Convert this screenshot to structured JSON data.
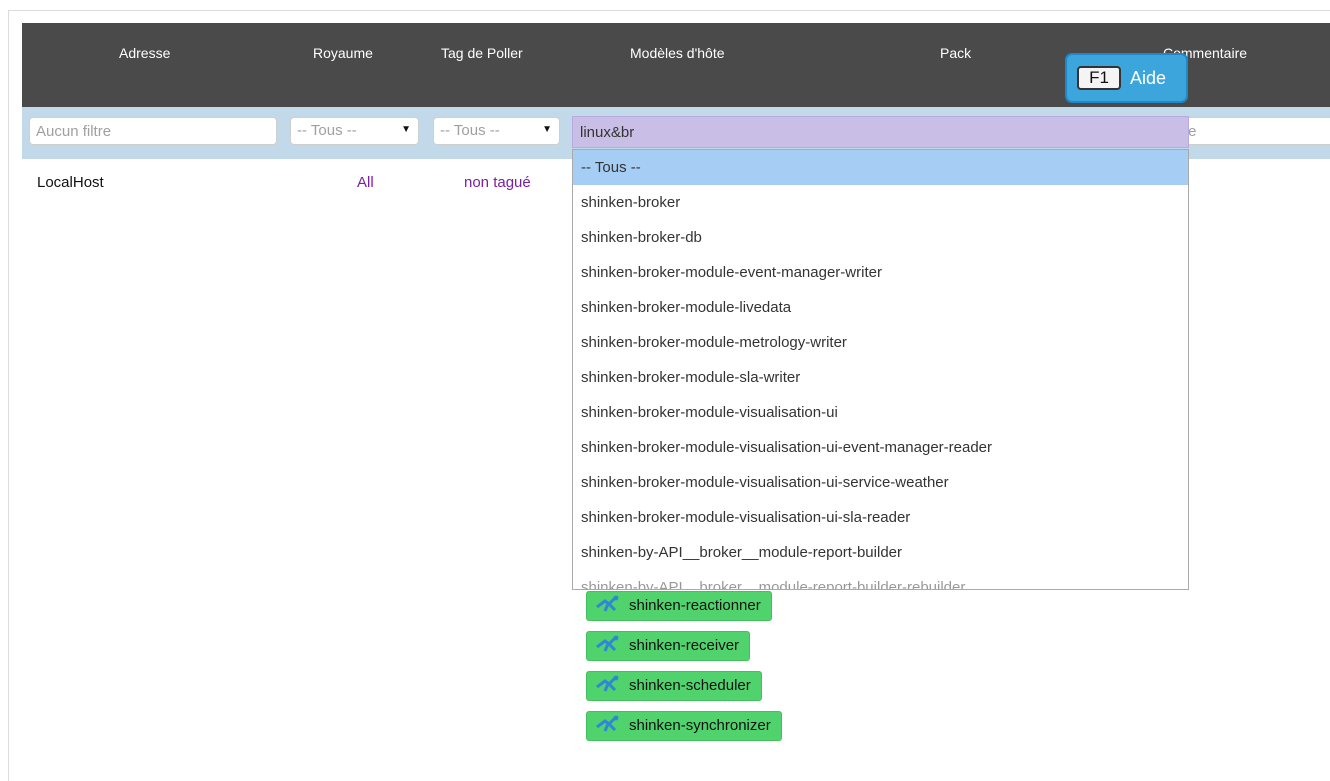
{
  "columns": {
    "address": "Adresse",
    "realm": "Royaume",
    "poller_tag": "Tag de Poller",
    "host_templates": "Modèles d'hôte",
    "pack": "Pack",
    "comment": "Commentaire"
  },
  "filters": {
    "address_placeholder": "Aucun filtre",
    "realm_value": "-- Tous --",
    "poller_tag_value": "-- Tous --",
    "host_template_value": "linux&br",
    "comment_placeholder_visible": "tre"
  },
  "dropdown": {
    "options": [
      "-- Tous --",
      "shinken-broker",
      "shinken-broker-db",
      "shinken-broker-module-event-manager-writer",
      "shinken-broker-module-livedata",
      "shinken-broker-module-metrology-writer",
      "shinken-broker-module-sla-writer",
      "shinken-broker-module-visualisation-ui",
      "shinken-broker-module-visualisation-ui-event-manager-reader",
      "shinken-broker-module-visualisation-ui-service-weather",
      "shinken-broker-module-visualisation-ui-sla-reader",
      "shinken-by-API__broker__module-report-builder",
      "shinken-by-API__broker__module-report-builder-rebuilder"
    ]
  },
  "row": {
    "host": "LocalHost",
    "realm": "All",
    "poller_tag": "non tagué",
    "templates": [
      "shinken-reactionner",
      "shinken-receiver",
      "shinken-scheduler",
      "shinken-synchronizer"
    ]
  },
  "help": {
    "key": "F1",
    "label": "Aide"
  },
  "colors": {
    "header_bg": "#4a4a4a",
    "filter_bar_bg": "#c2d9ea",
    "combo_bg": "#c9bfe6",
    "selected_option_bg": "#a6cdf3",
    "template_tag_bg": "#50d26d",
    "link_purple": "#7b1fa2",
    "help_bg": "#3ba5dc"
  },
  "icons": {
    "template_tag": "shinken-runner-icon",
    "select_caret": "caret-down-icon"
  }
}
